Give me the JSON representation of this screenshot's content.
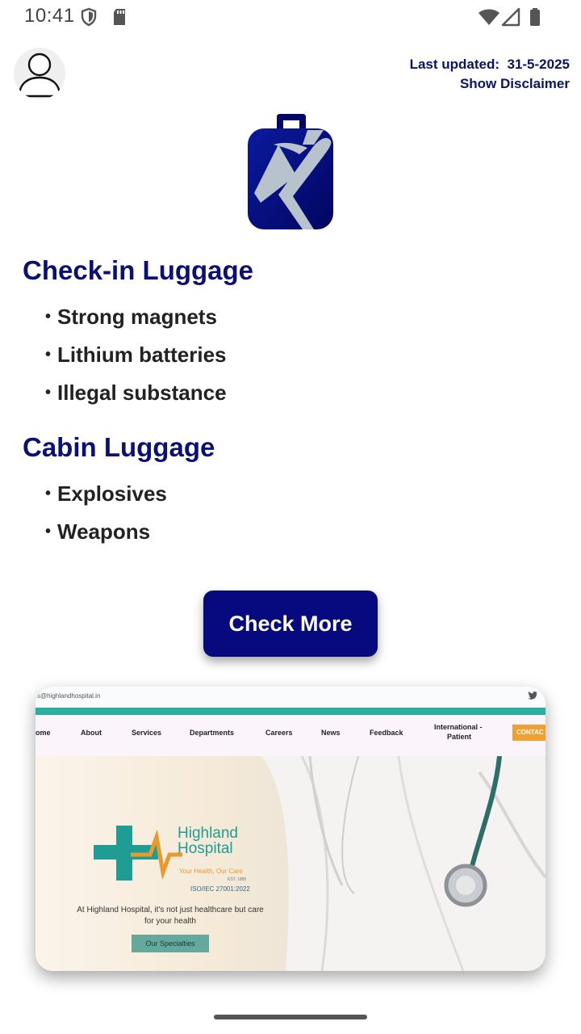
{
  "status_bar": {
    "time": "10:41",
    "icons": [
      "shield-icon",
      "sd-card-icon",
      "wifi-icon",
      "signal-icon",
      "battery-icon"
    ]
  },
  "header": {
    "avatar_icon": "user-profile-icon",
    "last_updated_label": "Last updated:",
    "last_updated_date": "31-5-2025",
    "disclaimer_link": "Show Disclaimer"
  },
  "hero_icon": "luggage-airplane-icon",
  "sections": {
    "checkin": {
      "title": "Check-in Luggage",
      "items": [
        "Strong magnets",
        "Lithium batteries",
        "Illegal substance"
      ]
    },
    "cabin": {
      "title": "Cabin Luggage",
      "items": [
        "Explosives",
        "Weapons"
      ]
    }
  },
  "check_more_button": "Check More",
  "ad_preview": {
    "email": "s@highlandhospital.in",
    "nav": [
      "ome",
      "About",
      "Services",
      "Departments",
      "Careers",
      "News",
      "Feedback",
      "International -",
      "Patient"
    ],
    "contact_button": "CONTAC",
    "brand_line1": "Highland",
    "brand_line2": "Hospital",
    "tagline": "Your Health, Our Care",
    "est": "EST. 1989",
    "iso": "ISO/IEC 27001:2022",
    "description": "At Highland Hospital, it's not just healthcare but care for your health",
    "cta": "Our Specialties"
  },
  "colors": {
    "primary_navy": "#07097f",
    "title_navy": "#0a1074",
    "teal": "#1f9c93",
    "orange": "#f0a032"
  }
}
